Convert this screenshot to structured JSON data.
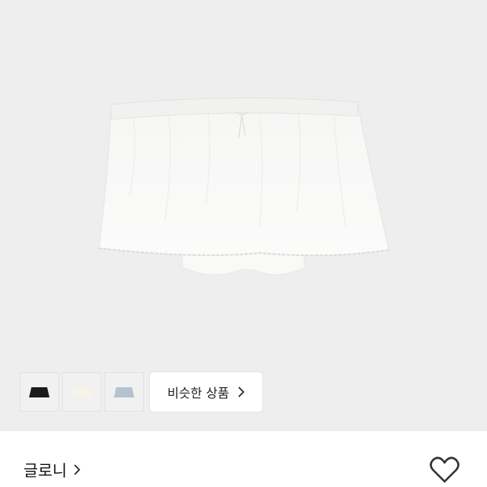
{
  "product": {
    "image": "white-lace-trim-bloomer-skirt",
    "colors": [
      {
        "name": "black",
        "swatch": "#1b1b1b"
      },
      {
        "name": "ivory",
        "swatch": "#f6f3e8"
      },
      {
        "name": "light-blue",
        "swatch": "#b5c3cf"
      }
    ]
  },
  "similar": {
    "label": "비슷한 상품",
    "icon": "chevron-right-icon"
  },
  "brand": {
    "name": "글로니",
    "icon": "chevron-right-icon"
  },
  "wishlist": {
    "icon": "heart-outline-icon"
  }
}
